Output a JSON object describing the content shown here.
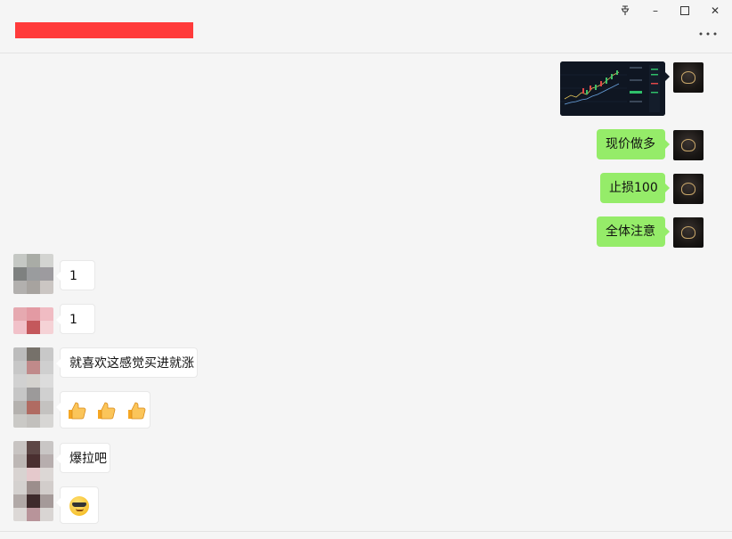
{
  "window": {
    "pin_icon": "pin-icon",
    "minimize_glyph": "–",
    "maximize_glyph": "☐",
    "close_glyph": "✕",
    "more_glyph": "•••",
    "title_redacted_color": "#ff3b3b"
  },
  "messages": {
    "self": [
      {
        "type": "image",
        "content": "candlestick-chart-screenshot"
      },
      {
        "type": "text",
        "text": "现价做多"
      },
      {
        "type": "text",
        "text": "止损100"
      },
      {
        "type": "text",
        "text": "全体注意"
      }
    ],
    "others": [
      {
        "type": "text",
        "text": "1"
      },
      {
        "type": "text",
        "text": "1"
      },
      {
        "type": "text",
        "text": "就喜欢这感觉买进就涨"
      },
      {
        "type": "emoji",
        "content": "thumbs-up-x3"
      },
      {
        "type": "text",
        "text": "爆拉吧"
      },
      {
        "type": "emoji",
        "content": "cool-sunglasses-face"
      }
    ]
  },
  "colors": {
    "self_bubble": "#95ec69",
    "other_bubble": "#ffffff",
    "background": "#f5f5f5"
  }
}
